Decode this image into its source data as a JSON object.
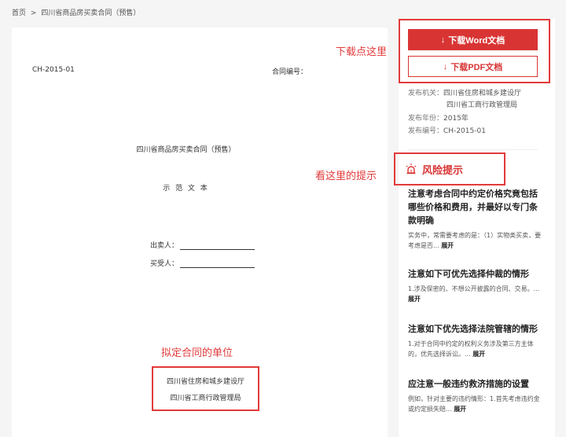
{
  "breadcrumb": {
    "home": "首页",
    "sep": ">",
    "current": "四川省商品房买卖合同（预售）"
  },
  "document": {
    "code": "CH-2015-01",
    "contract_no_label": "合同编号：",
    "title": "四川省商品房买卖合同（预售）",
    "subtitle": "示 范 文 本",
    "seller_label": "出卖人：",
    "buyer_label": "买受人：",
    "issuers": [
      "四川省住房和城乡建设厅",
      "四川省工商行政管理局"
    ]
  },
  "annotations": {
    "download": "下载点这里",
    "risk": "看这里的提示",
    "unit": "拟定合同的单位"
  },
  "sidebar": {
    "download_word": "下载Word文档",
    "download_pdf": "下载PDF文档",
    "meta": {
      "issuer_label": "发布机关：",
      "issuer_1": "四川省住房和城乡建设厅",
      "issuer_2": "四川省工商行政管理局",
      "year_label": "发布年份：",
      "year": "2015年",
      "code_label": "发布编号：",
      "code": "CH-2015-01"
    },
    "risk_title": "风险提示",
    "risks": [
      {
        "title": "注意考虑合同中约定价格究竟包括哪些价格和费用，并最好以专门条款明确",
        "desc": "实务中，常需要考虑的是：（1）实物类买卖，要考虑是否...",
        "more": "展开"
      },
      {
        "title": "注意如下可优先选择仲裁的情形",
        "desc": "1.涉及保密的、不想公开披露的合同、交易。...",
        "more": "展开"
      },
      {
        "title": "注意如下优先选择法院管辖的情形",
        "desc": "1.对于合同中约定的权利义务涉及第三方主体的，优先选择诉讼。...",
        "more": "展开"
      },
      {
        "title": "应注意一般违约救济措施的设置",
        "desc": "例如，针对主要的违约情形：1.首先考虑违约金或约定损失赔...",
        "more": "展开"
      }
    ]
  },
  "colors": {
    "accent": "#d93434",
    "annotation": "#e23a3a"
  }
}
